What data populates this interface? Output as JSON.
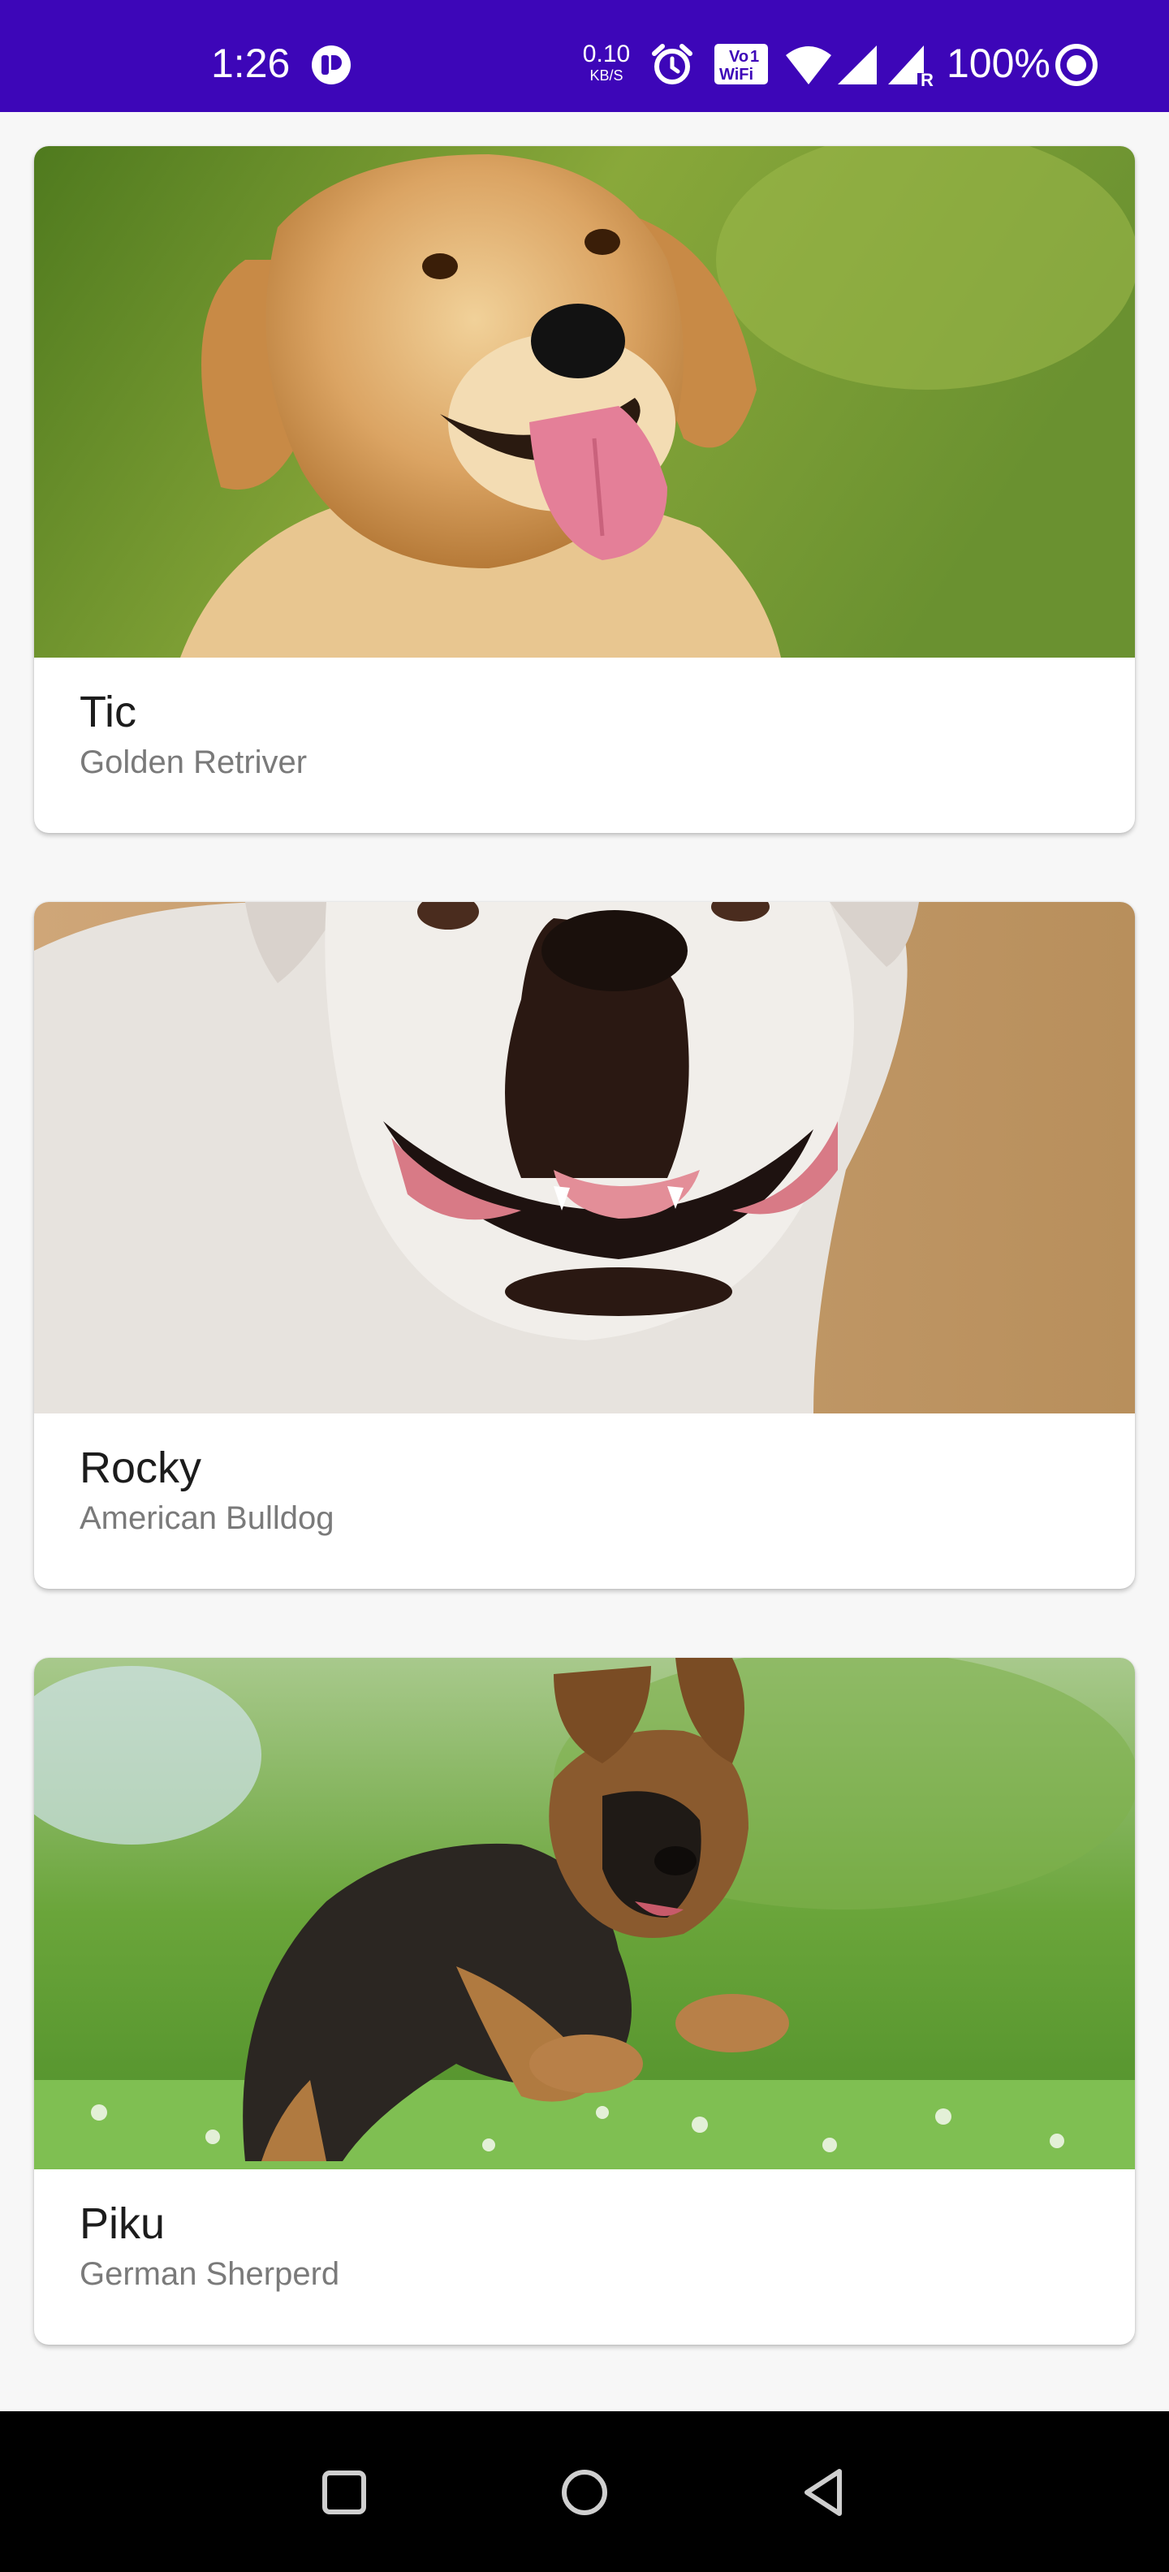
{
  "status_bar": {
    "time": "1:26",
    "net_speed_value": "0.10",
    "net_speed_unit": "KB/S",
    "volte_label": "Vo",
    "wifi_label": "WiFi",
    "sim_label": "1",
    "battery_percent": "100%",
    "background_color": "#3d06b8",
    "icons": [
      "app-notification-icon",
      "alarm-clock-icon",
      "vowifi-icon",
      "wifi-signal-icon",
      "cell-signal-icon",
      "cell-signal-roaming-icon",
      "battery-saver-icon"
    ]
  },
  "dogs": [
    {
      "name": "Tic",
      "breed": "Golden Retriver",
      "image": "golden-retriever-photo"
    },
    {
      "name": "Rocky",
      "breed": "American Bulldog",
      "image": "american-bulldog-photo"
    },
    {
      "name": "Piku",
      "breed": "German Sherperd",
      "image": "german-shepherd-puppy-photo"
    }
  ],
  "nav_bar": {
    "buttons": [
      "recents-square-icon",
      "home-circle-icon",
      "back-triangle-icon"
    ]
  }
}
